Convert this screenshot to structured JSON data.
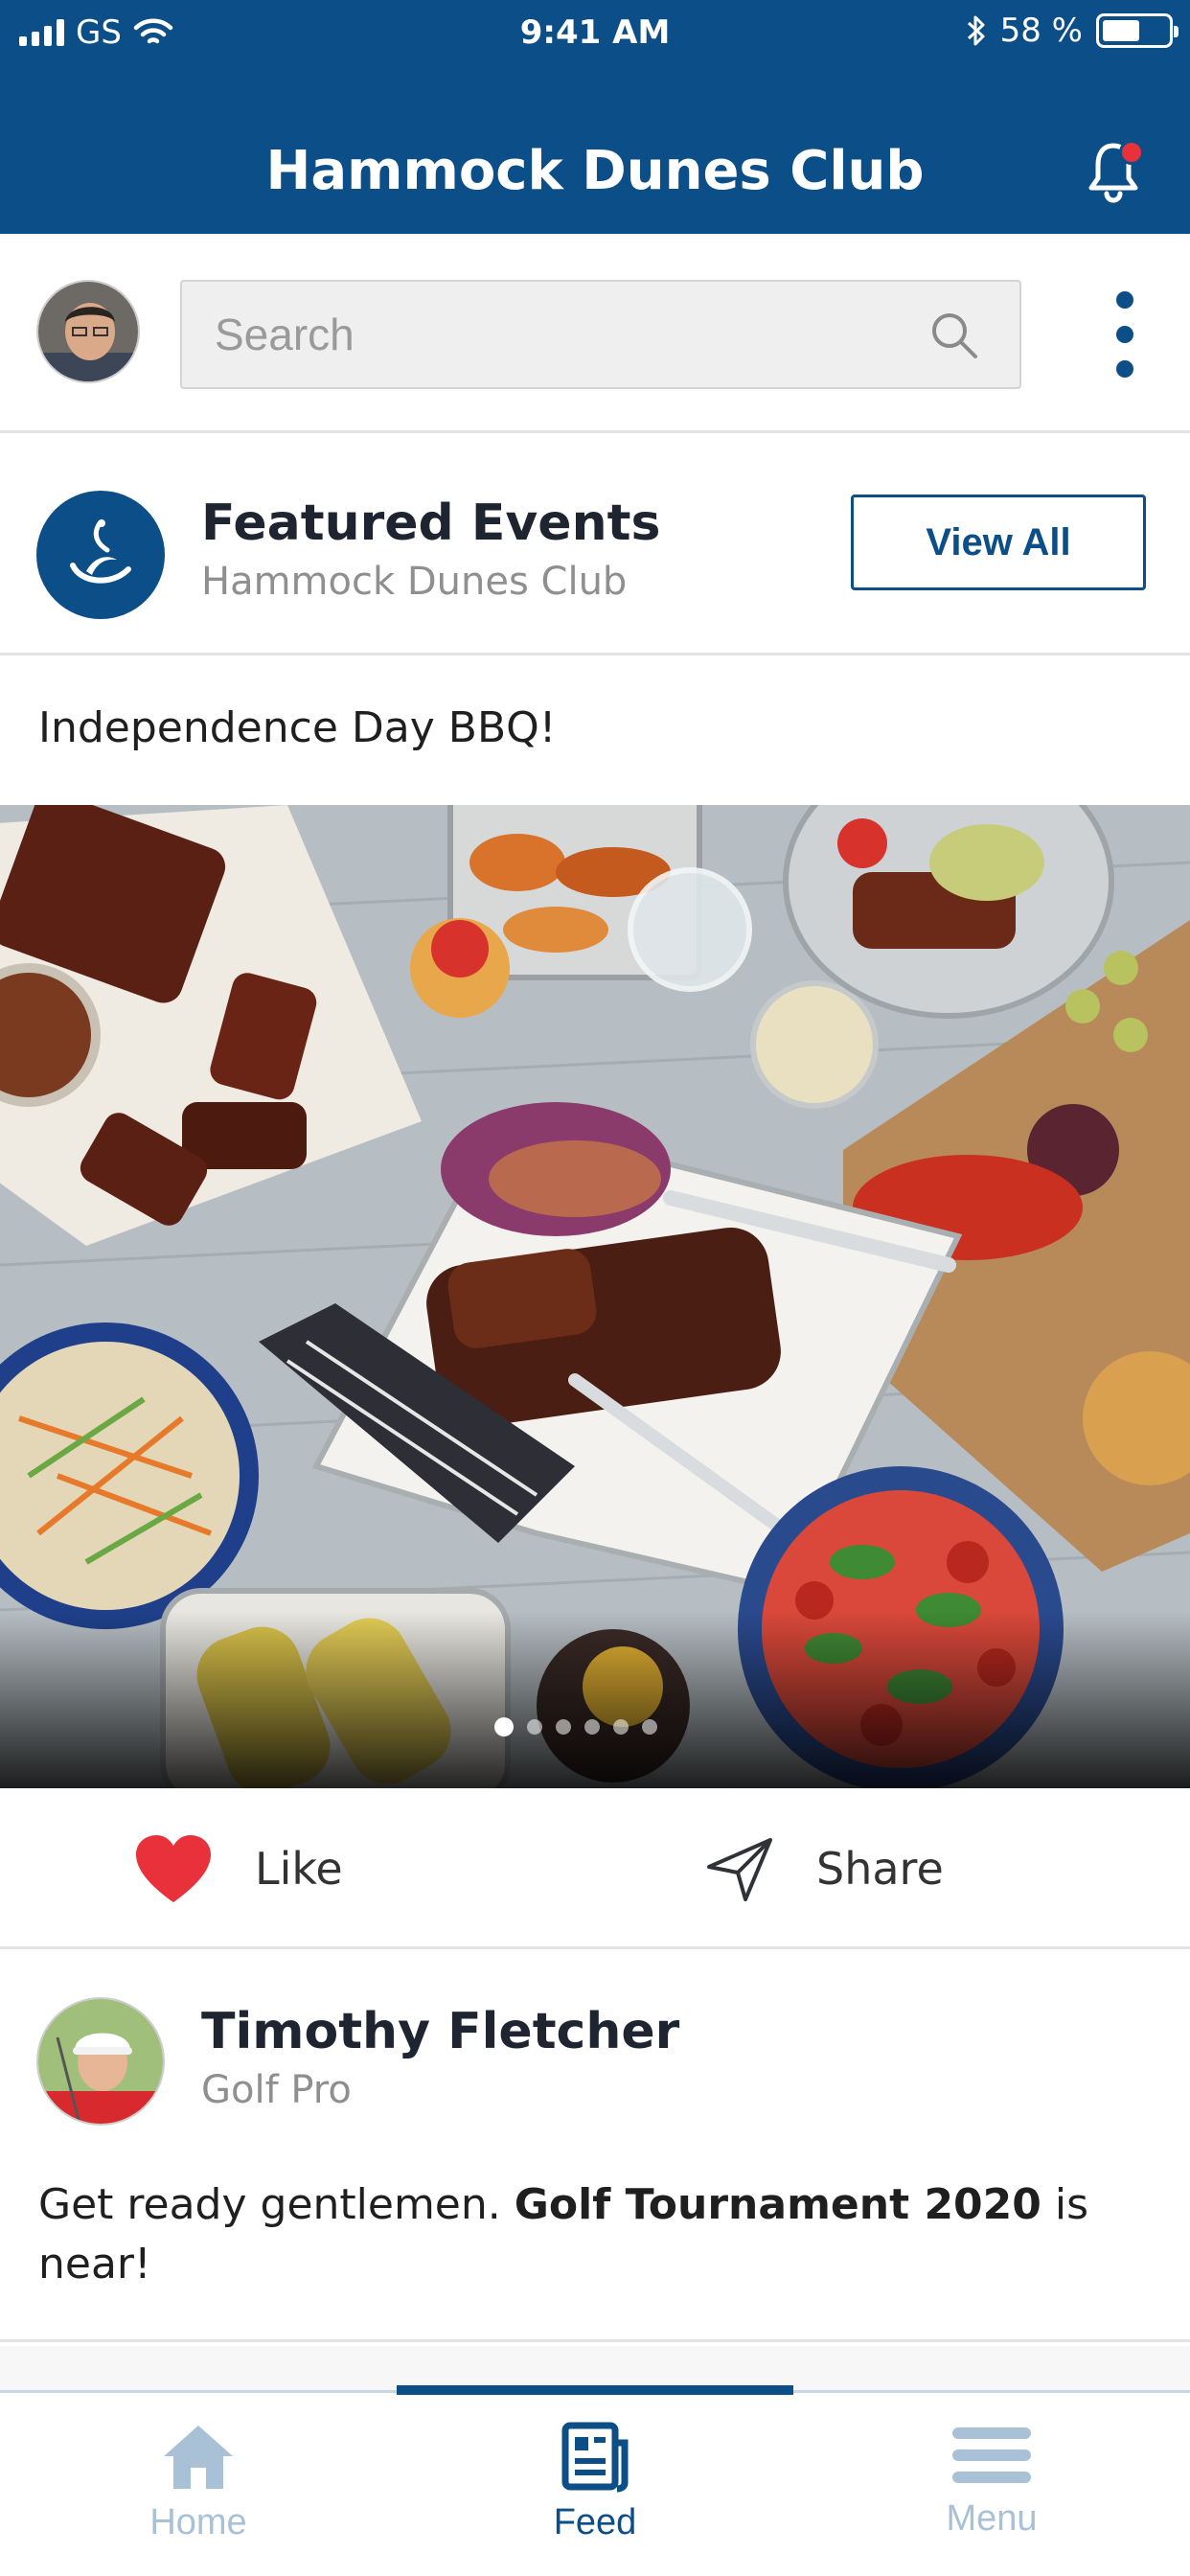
{
  "status_bar": {
    "carrier": "GS",
    "time": "9:41 AM",
    "battery_text": "58 %",
    "battery_level": 0.58
  },
  "header": {
    "title": "Hammock Dunes Club",
    "has_notification": true
  },
  "search": {
    "placeholder": "Search"
  },
  "featured": {
    "title": "Featured Events",
    "subtitle": "Hammock Dunes Club",
    "view_all_label": "View All"
  },
  "event": {
    "title": "Independence Day BBQ!",
    "carousel_count": 6,
    "carousel_active": 1
  },
  "actions": {
    "like_label": "Like",
    "share_label": "Share"
  },
  "post": {
    "author": "Timothy Fletcher",
    "role": "Golf Pro",
    "text_before": "Get ready gentlemen. ",
    "text_bold": "Golf Tournament 2020",
    "text_after": " is near!"
  },
  "tabs": [
    {
      "label": "Home",
      "icon": "home-icon",
      "active": false
    },
    {
      "label": "Feed",
      "icon": "feed-icon",
      "active": true
    },
    {
      "label": "Menu",
      "icon": "menu-icon",
      "active": false
    }
  ],
  "colors": {
    "brand": "#0c4f88",
    "notification": "#e8313b",
    "like": "#e8313b",
    "inactive_tab": "#a9c1d6"
  }
}
